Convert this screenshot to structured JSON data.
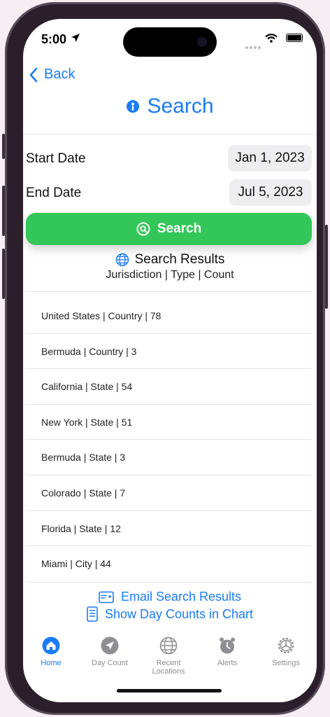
{
  "status": {
    "time": "5:00"
  },
  "nav": {
    "back_label": "Back"
  },
  "header": {
    "title": "Search"
  },
  "dates": {
    "start_label": "Start Date",
    "start_value": "Jan 1, 2023",
    "end_label": "End Date",
    "end_value": "Jul 5, 2023"
  },
  "search_button": {
    "label": "Search"
  },
  "results": {
    "title": "Search Results",
    "subtitle": "Jurisdiction | Type | Count",
    "items": [
      "United States | Country |  78",
      "Bermuda | Country |  3",
      "California | State | 54",
      "New York | State | 51",
      "Bermuda | State | 3",
      "Colorado | State | 7",
      "Florida | State | 12",
      "Miami | City |  44"
    ]
  },
  "actions": {
    "email_label": "Email Search Results",
    "chart_label": "Show Day Counts in Chart"
  },
  "tabs": [
    {
      "label": "Home",
      "icon": "house-icon",
      "active": true
    },
    {
      "label": "Day Count",
      "icon": "location-arrow-icon",
      "active": false
    },
    {
      "label": "Recent Locations",
      "icon": "globe-icon",
      "active": false
    },
    {
      "label": "Alerts",
      "icon": "alarm-clock-icon",
      "active": false
    },
    {
      "label": "Settings",
      "icon": "gear-icon",
      "active": false
    }
  ],
  "colors": {
    "accent": "#1a7cf5",
    "search_button": "#33c759",
    "tab_inactive": "#8e8e93"
  }
}
